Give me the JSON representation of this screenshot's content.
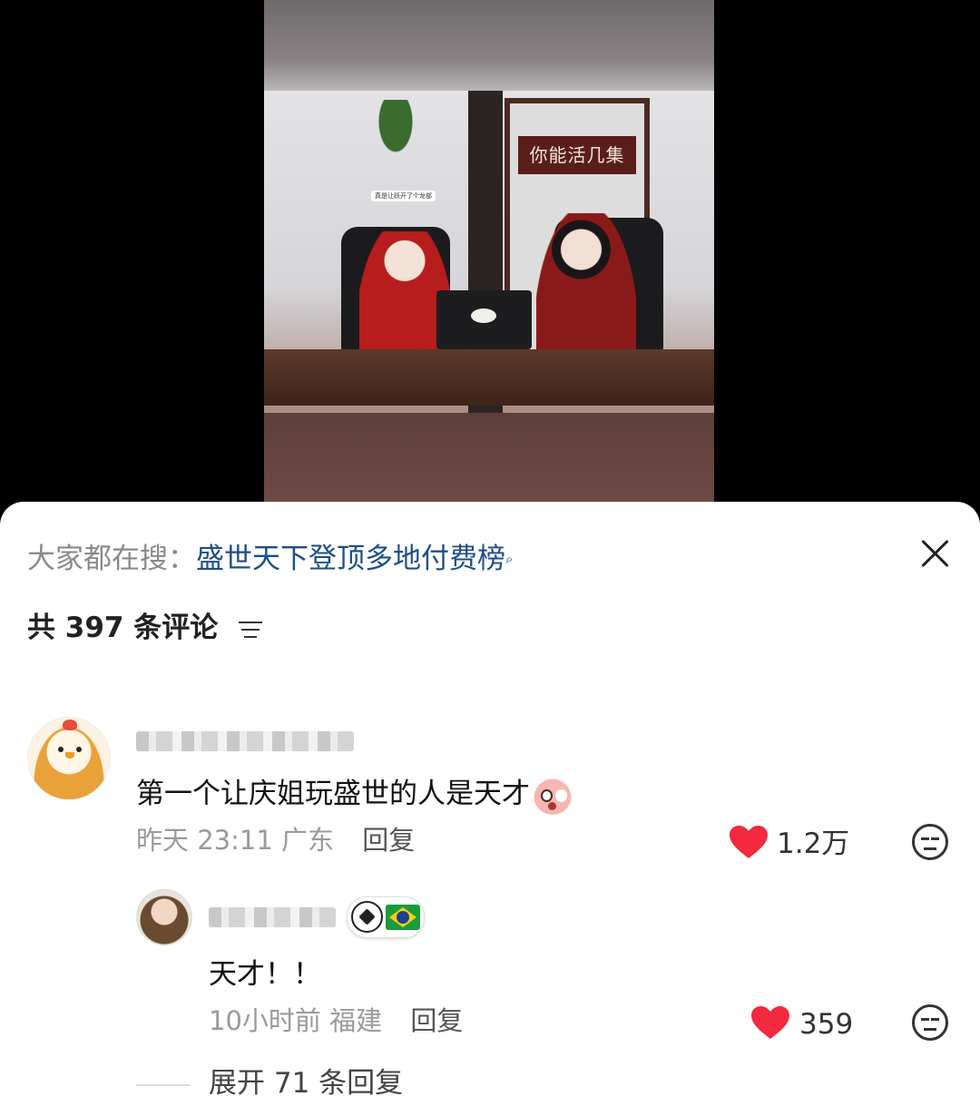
{
  "video": {
    "sign_text": "你能活几集",
    "caption_chip": "真是让跃开了个龙部"
  },
  "search_bar": {
    "prefix": "大家都在搜：",
    "term": "盛世天下登顶多地付费榜",
    "search_icon": "search-icon",
    "close_icon": "close-icon"
  },
  "comments_header": {
    "count_text": "共 397 条评论",
    "sort_icon": "sort-icon"
  },
  "comments": [
    {
      "avatar": "chick-avatar",
      "text": "第一个让庆姐玩盛世的人是天才",
      "emoji": "shocked-face-icon",
      "time": "昨天 23:11",
      "location": "广东",
      "reply_label": "回复",
      "likes": "1.2万",
      "replies": [
        {
          "avatar": "user-avatar",
          "badge": [
            "soccer-ball-icon",
            "brazil-flag-icon"
          ],
          "text": "天才！！",
          "time": "10小时前",
          "location": "福建",
          "reply_label": "回复",
          "likes": "359"
        }
      ],
      "expand_label": "展开 71 条回复"
    }
  ],
  "colors": {
    "like_red": "#f2293f",
    "search_term": "#1d4e89",
    "meta_gray": "#9a9a9a"
  }
}
